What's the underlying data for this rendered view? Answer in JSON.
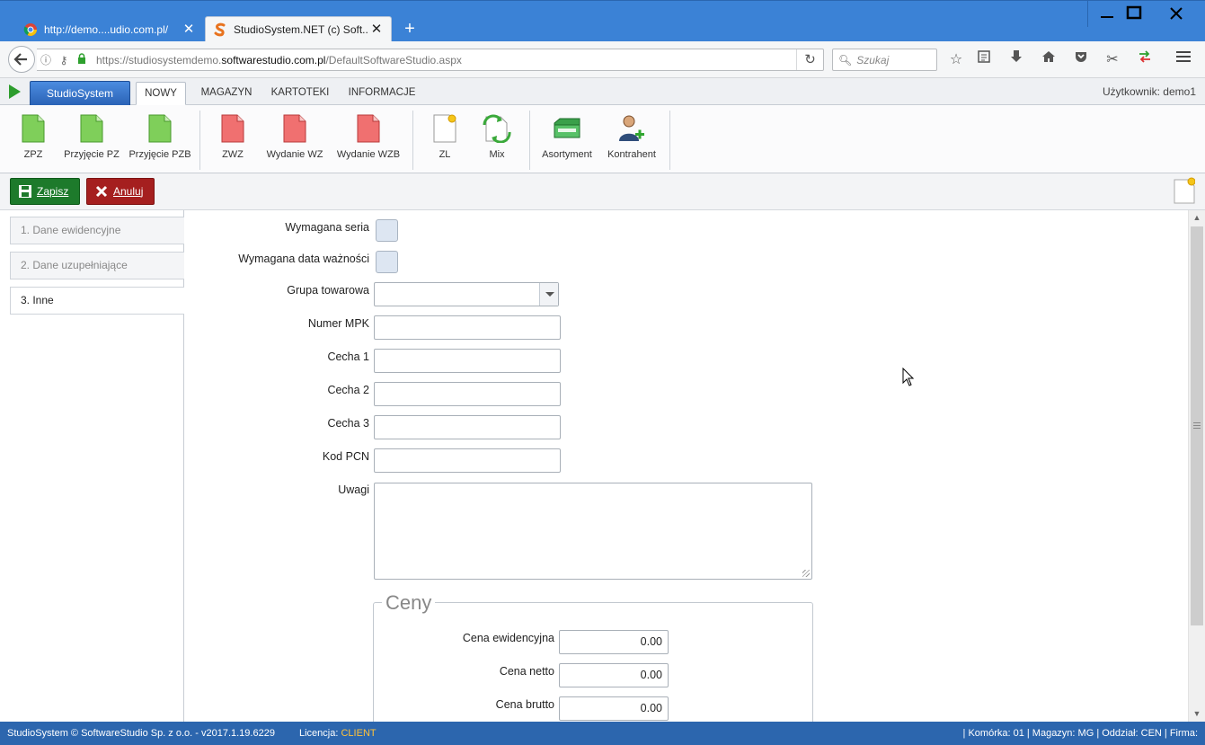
{
  "browser": {
    "tabs": [
      {
        "title": "http://demo....udio.com.pl/",
        "active": false
      },
      {
        "title": "StudioSystem.NET (c) Soft...",
        "active": true
      }
    ],
    "url_prefix": "https://studiosystemdemo.",
    "url_domain": "softwarestudio.com.pl",
    "url_path": "/DefaultSoftwareStudio.aspx",
    "search_placeholder": "Szukaj"
  },
  "app": {
    "brand": "StudioSystem",
    "menu_tabs": [
      "NOWY",
      "MAGAZYN",
      "KARTOTEKI",
      "INFORMACJE"
    ],
    "user_label": "Użytkownik: demo1"
  },
  "ribbon": {
    "buttons": [
      {
        "label": "ZPZ",
        "icon": "green-document-icon"
      },
      {
        "label": "Przyjęcie PZ",
        "icon": "green-document-icon"
      },
      {
        "label": "Przyjęcie PZB",
        "icon": "green-document-icon"
      },
      {
        "label": "ZWZ",
        "icon": "red-document-icon"
      },
      {
        "label": "Wydanie WZ",
        "icon": "red-document-icon"
      },
      {
        "label": "Wydanie WZB",
        "icon": "red-document-icon"
      },
      {
        "label": "ZL",
        "icon": "new-document-icon"
      },
      {
        "label": "Mix",
        "icon": "mix-document-icon"
      },
      {
        "label": "Asortyment",
        "icon": "box-icon"
      },
      {
        "label": "Kontrahent",
        "icon": "add-person-icon"
      }
    ]
  },
  "actions": {
    "save": "Zapisz",
    "cancel": "Anuluj"
  },
  "sidenav": {
    "items": [
      "1. Dane ewidencyjne",
      "2. Dane uzupełniające",
      "3. Inne"
    ],
    "active_index": 2
  },
  "form": {
    "series_required": "Wymagana seria",
    "expiry_required": "Wymagana data ważności",
    "group": "Grupa towarowa",
    "mpk": "Numer MPK",
    "feature1": "Cecha 1",
    "feature2": "Cecha 2",
    "feature3": "Cecha 3",
    "pcn": "Kod PCN",
    "notes": "Uwagi",
    "prices_legend": "Ceny",
    "price_record": "Cena ewidencyjna",
    "price_net": "Cena netto",
    "price_gross": "Cena brutto",
    "price_record_value": "0.00",
    "price_net_value": "0.00",
    "price_gross_value": "0.00"
  },
  "status": {
    "left": "StudioSystem © SoftwareStudio Sp. z o.o. - v2017.1.19.6229",
    "license_label": "Licencja:",
    "license_value": "CLIENT",
    "right": "| Komórka: 01 | Magazyn: MG | Oddział: CEN | Firma:"
  },
  "colors": {
    "brand_blue": "#2c66ae",
    "save_green": "#1d7a2b",
    "cancel_red": "#a51f1f",
    "license_orange": "#ffc23a"
  }
}
